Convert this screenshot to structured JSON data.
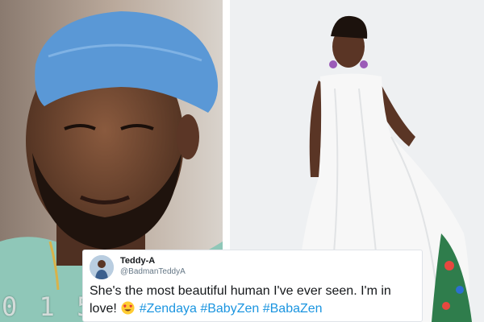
{
  "video": {
    "timer_text": "0 1 5"
  },
  "tweet": {
    "display_name": "Teddy-A",
    "handle": "@BadmanTeddyA",
    "text_main": "She's the most beautiful human I've ever seen. I'm in love! ",
    "hashtags": [
      "#Zendaya",
      "#BabyZen",
      "#BabaZen"
    ],
    "emoji_name": "heart-eyes-emoji"
  },
  "colors": {
    "hashtag_link": "#1b95e0",
    "text": "#14171a",
    "handle": "#657786",
    "hair_net": "#5a98d6",
    "gown": "#f7f7f7"
  }
}
